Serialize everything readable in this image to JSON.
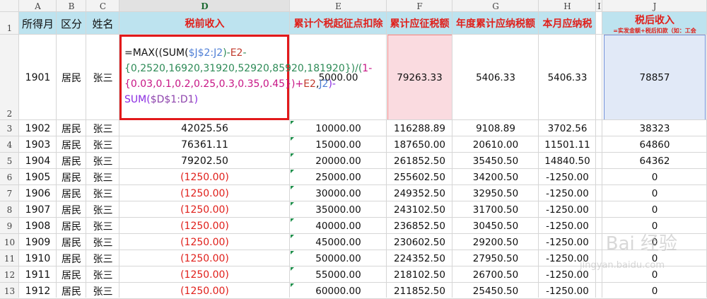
{
  "columns": [
    "A",
    "B",
    "C",
    "D",
    "E",
    "F",
    "G",
    "H",
    "I",
    "J"
  ],
  "header_row": {
    "a": "所得月",
    "b": "区分",
    "c": "姓名",
    "d": "税前收入",
    "e": "累计个税起征点扣除",
    "f": "累计应征税额",
    "g": "年度累计应纳税额",
    "h": "本月应纳税",
    "j": "税后收入",
    "j_note": "=实发金额+税后扣款（如：工会"
  },
  "formula": {
    "parts": [
      "=MAX((SUM(",
      "$J$2:J2",
      ")-",
      "E2",
      "-{0,2520,16920,31920,52920,85920,181920})/(",
      "1-{0.03,0.1,0.2,0.25,0.3,0.35,0.45})+",
      "E2",
      ",",
      "J2",
      ")-SUM(",
      "$D$1:D1",
      ")"
    ]
  },
  "rows": [
    {
      "num": "2",
      "a": "1901",
      "b": "居民",
      "c": "张三",
      "d": "",
      "e": "5000.00",
      "f": "79263.33",
      "g": "5406.33",
      "h": "5406.33",
      "j": "78857"
    },
    {
      "num": "3",
      "a": "1902",
      "b": "居民",
      "c": "张三",
      "d": "42025.56",
      "e": "10000.00",
      "f": "116288.89",
      "g": "9108.89",
      "h": "3702.56",
      "j": "38323"
    },
    {
      "num": "4",
      "a": "1903",
      "b": "居民",
      "c": "张三",
      "d": "76361.11",
      "e": "15000.00",
      "f": "187650.00",
      "g": "20610.00",
      "h": "11501.11",
      "j": "64860"
    },
    {
      "num": "5",
      "a": "1904",
      "b": "居民",
      "c": "张三",
      "d": "79202.50",
      "e": "20000.00",
      "f": "261852.50",
      "g": "35450.50",
      "h": "14840.50",
      "j": "64362"
    },
    {
      "num": "6",
      "a": "1905",
      "b": "居民",
      "c": "张三",
      "d": "(1250.00)",
      "e": "25000.00",
      "f": "255602.50",
      "g": "34200.50",
      "h": "-1250.00",
      "j": "0"
    },
    {
      "num": "7",
      "a": "1906",
      "b": "居民",
      "c": "张三",
      "d": "(1250.00)",
      "e": "30000.00",
      "f": "249352.50",
      "g": "32950.50",
      "h": "-1250.00",
      "j": "0"
    },
    {
      "num": "8",
      "a": "1907",
      "b": "居民",
      "c": "张三",
      "d": "(1250.00)",
      "e": "35000.00",
      "f": "243102.50",
      "g": "31700.50",
      "h": "-1250.00",
      "j": "0"
    },
    {
      "num": "9",
      "a": "1908",
      "b": "居民",
      "c": "张三",
      "d": "(1250.00)",
      "e": "40000.00",
      "f": "236852.50",
      "g": "30450.50",
      "h": "-1250.00",
      "j": "0"
    },
    {
      "num": "10",
      "a": "1909",
      "b": "居民",
      "c": "张三",
      "d": "(1250.00)",
      "e": "45000.00",
      "f": "230602.50",
      "g": "29200.50",
      "h": "-1250.00",
      "j": "0"
    },
    {
      "num": "11",
      "a": "1910",
      "b": "居民",
      "c": "张三",
      "d": "(1250.00)",
      "e": "50000.00",
      "f": "224352.50",
      "g": "27950.50",
      "h": "-1250.00",
      "j": "0"
    },
    {
      "num": "12",
      "a": "1911",
      "b": "居民",
      "c": "张三",
      "d": "(1250.00)",
      "e": "55000.00",
      "f": "218102.50",
      "g": "26700.50",
      "h": "-1250.00",
      "j": "0"
    },
    {
      "num": "13",
      "a": "1912",
      "b": "居民",
      "c": "张三",
      "d": "(1250.00)",
      "e": "60000.00",
      "f": "211852.50",
      "g": "25450.50",
      "h": "-1250.00",
      "j": "0"
    }
  ],
  "row1_num": "1",
  "watermark": "Bai 经验",
  "watermark_url": "jingyan.baidu.com",
  "colors": {
    "accent_red": "#e0201b",
    "header_fill": "#bde3ef",
    "e2_fill": "#fadbe0",
    "j2_fill": "#e1e9f7",
    "selected_border": "#e2191b"
  }
}
